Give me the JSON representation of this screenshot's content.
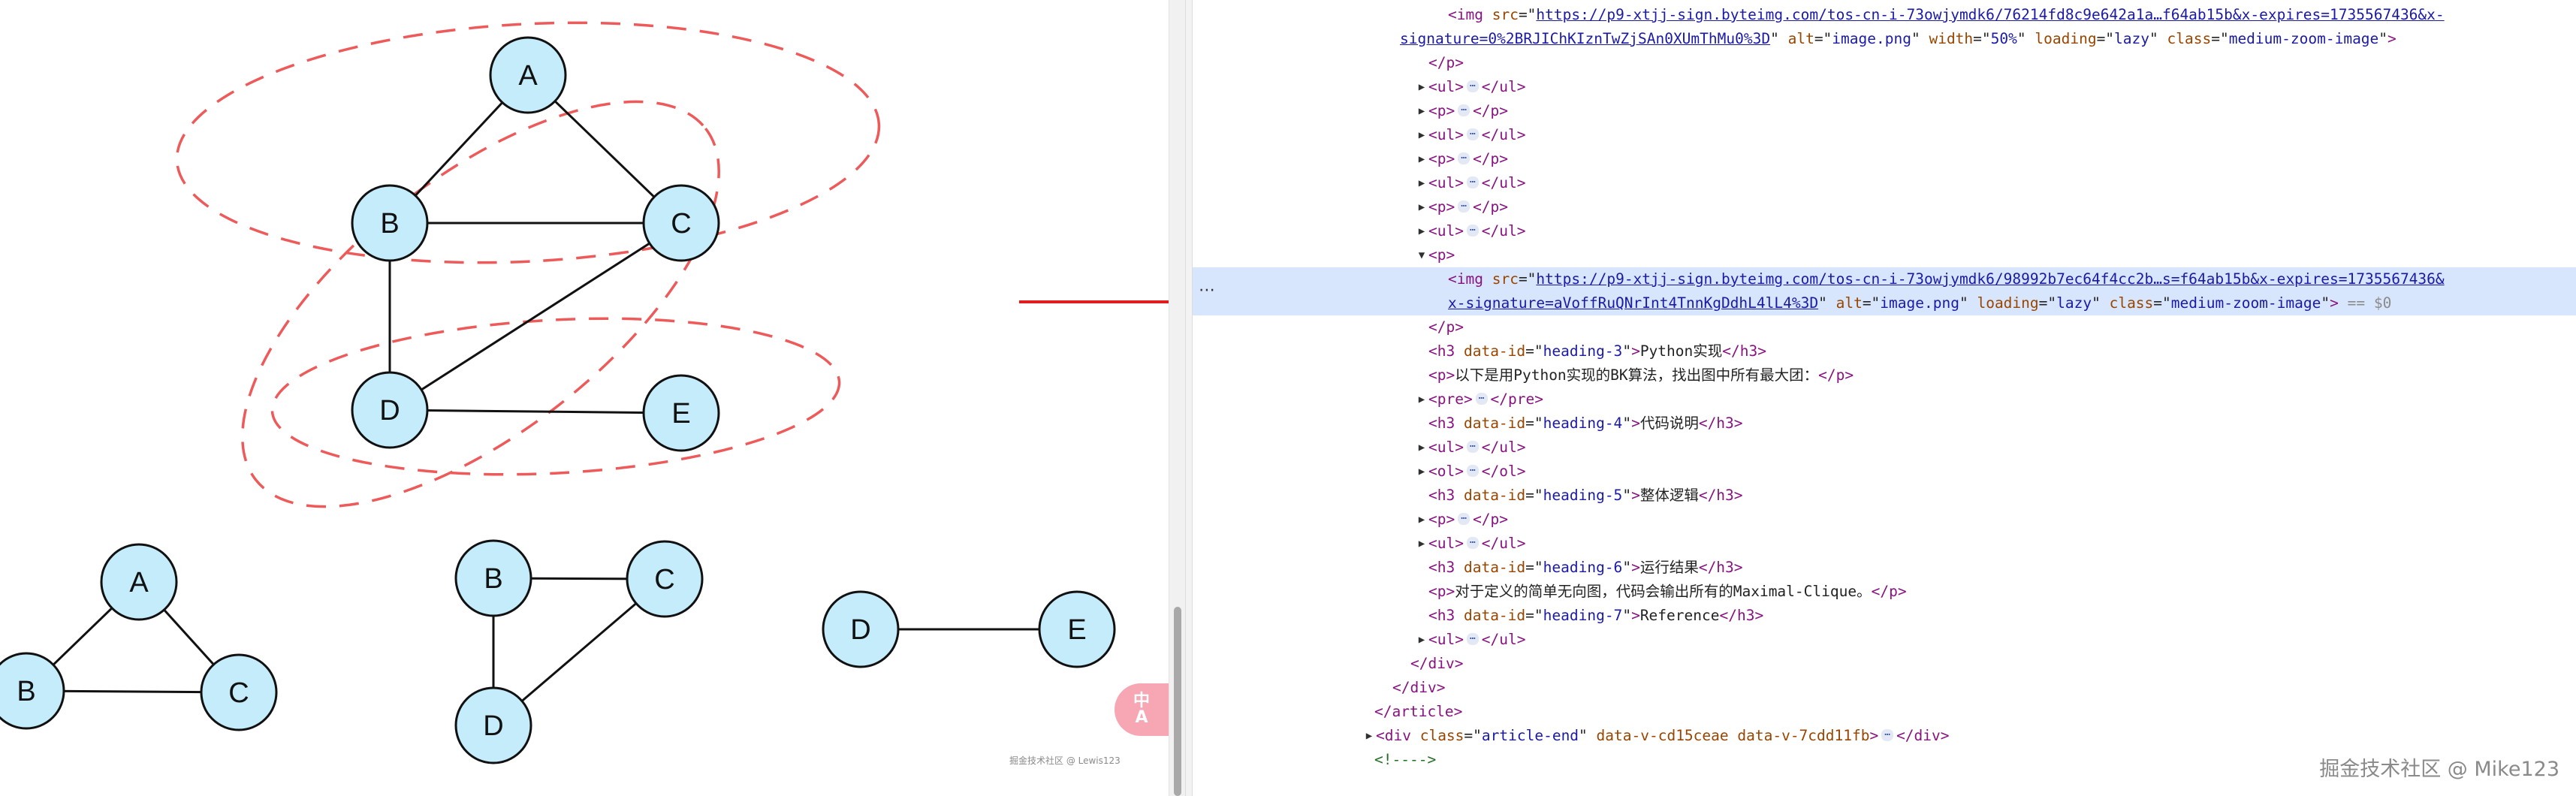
{
  "graph_top": {
    "nodes": [
      {
        "id": "A",
        "label": "A"
      },
      {
        "id": "B",
        "label": "B"
      },
      {
        "id": "C",
        "label": "C"
      },
      {
        "id": "D",
        "label": "D"
      },
      {
        "id": "E",
        "label": "E"
      }
    ],
    "edges": [
      [
        "A",
        "B"
      ],
      [
        "A",
        "C"
      ],
      [
        "B",
        "C"
      ],
      [
        "B",
        "D"
      ],
      [
        "C",
        "D"
      ],
      [
        "D",
        "E"
      ]
    ]
  },
  "cliques": [
    {
      "labels": [
        "A",
        "B",
        "C"
      ]
    },
    {
      "labels": [
        "B",
        "C",
        "D"
      ]
    },
    {
      "labels": [
        "D",
        "E"
      ]
    }
  ],
  "colors": {
    "node_fill": "#c5ecfb",
    "node_stroke": "#111111",
    "ellipse_dash": "#ee5a5a",
    "arrow": "#e11c1c",
    "selected_row": "#d8e6fd",
    "translate_button": "#f7a6b4"
  },
  "image_watermark": "掘金技术社区 @ Lewis123",
  "translate_button": {
    "label_line1": "中",
    "label_line2": "A",
    "icon": "translate-icon"
  },
  "devtools": {
    "rows": [
      {
        "type": "img1a",
        "src_text": "https://p9-xtjj-sign.byteimg.com/tos-cn-i-73owjymdk6/76214fd8c9e642a1a…f64ab15b&x-expires=1735567436&x-"
      },
      {
        "type": "img1b",
        "src_text": "signature=0%2BRJIChKIznTwZjSAn0XUmThMu0%3D",
        "alt": "image.png",
        "width": "50%",
        "loading": "lazy",
        "class": "medium-zoom-image"
      },
      {
        "type": "close",
        "tag": "p"
      },
      {
        "type": "collapsed",
        "tag": "ul"
      },
      {
        "type": "collapsed",
        "tag": "p"
      },
      {
        "type": "collapsed",
        "tag": "ul"
      },
      {
        "type": "collapsed",
        "tag": "p"
      },
      {
        "type": "collapsed",
        "tag": "ul"
      },
      {
        "type": "collapsed",
        "tag": "p"
      },
      {
        "type": "collapsed",
        "tag": "ul"
      },
      {
        "type": "open",
        "tag": "p"
      },
      {
        "type": "img2a",
        "src_text": "https://p9-xtjj-sign.byteimg.com/tos-cn-i-73owjymdk6/98992b7ec64f4cc2b…s=f64ab15b&x-expires=1735567436&"
      },
      {
        "type": "img2b",
        "src_text": "x-signature=aVoffRuQNrInt4TnnKgDdhL4lL4%3D",
        "alt": "image.png",
        "loading": "lazy",
        "class": "medium-zoom-image",
        "eq": "== $0"
      },
      {
        "type": "close",
        "tag": "p"
      },
      {
        "type": "heading",
        "id": "heading-3",
        "text": "Python实现"
      },
      {
        "type": "ptext",
        "text": "以下是用Python实现的BK算法，找出图中所有最大团："
      },
      {
        "type": "collapsed",
        "tag": "pre"
      },
      {
        "type": "heading",
        "id": "heading-4",
        "text": "代码说明"
      },
      {
        "type": "collapsed",
        "tag": "ul"
      },
      {
        "type": "collapsed",
        "tag": "ol"
      },
      {
        "type": "heading",
        "id": "heading-5",
        "text": "整体逻辑"
      },
      {
        "type": "collapsed",
        "tag": "p"
      },
      {
        "type": "collapsed",
        "tag": "ul"
      },
      {
        "type": "heading",
        "id": "heading-6",
        "text": "运行结果"
      },
      {
        "type": "ptext",
        "text": "对于定义的简单无向图，代码会输出所有的Maximal-Clique。"
      },
      {
        "type": "heading",
        "id": "heading-7",
        "text": "Reference"
      },
      {
        "type": "collapsed",
        "tag": "ul"
      },
      {
        "type": "close",
        "tag": "div"
      },
      {
        "type": "close",
        "tag": "div"
      },
      {
        "type": "close",
        "tag": "article"
      },
      {
        "type": "articleend",
        "class": "article-end",
        "attr1": "data-v-cd15ceae",
        "attr2": "data-v-7cdd11fb"
      },
      {
        "type": "comment",
        "text": "<!---->"
      }
    ],
    "ellipsis_badge": "⋯",
    "row_handle": "⋯"
  },
  "page_watermark": "掘金技术社区 @ Mike123"
}
